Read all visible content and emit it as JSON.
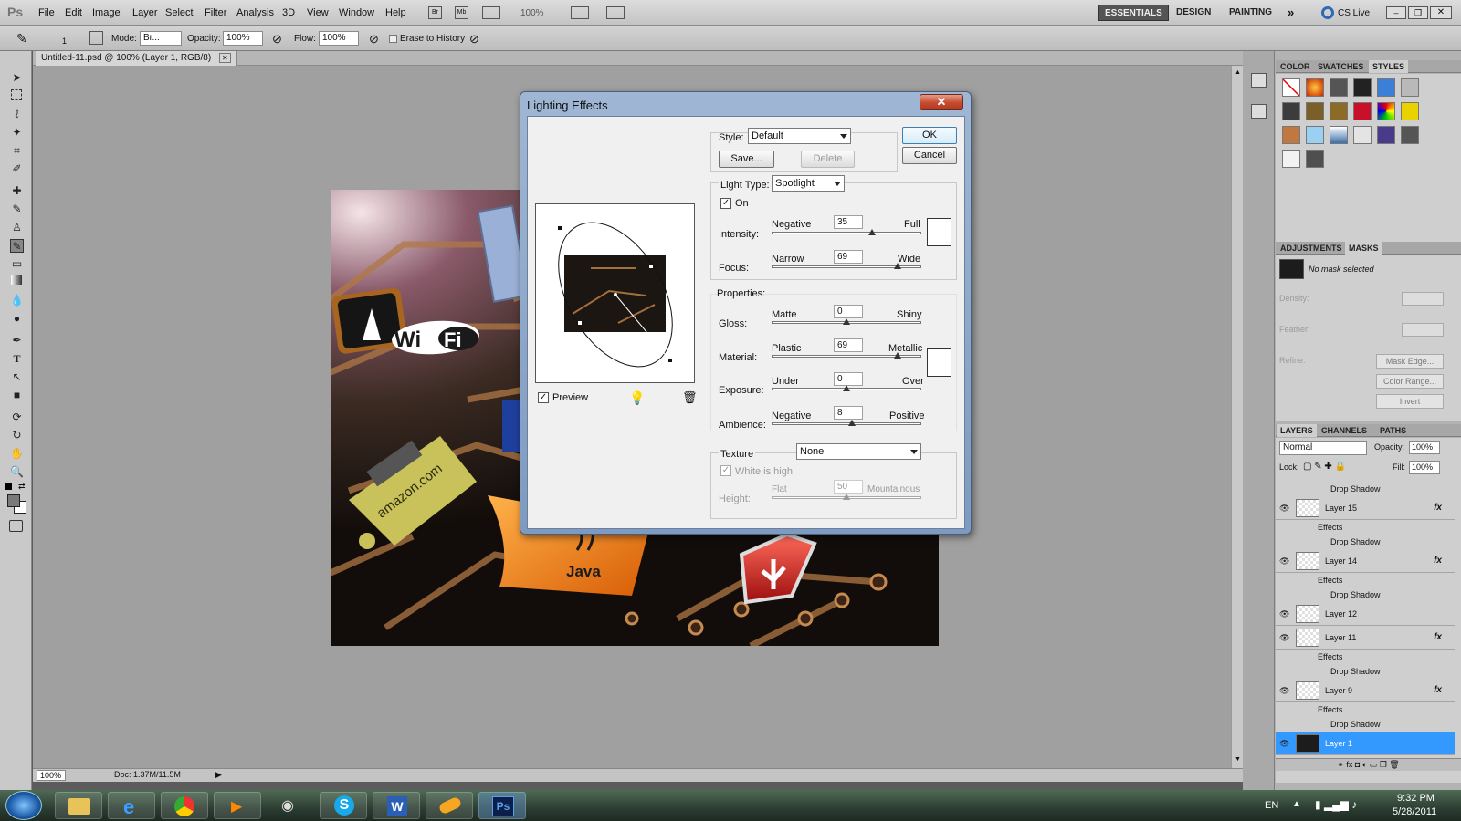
{
  "app": {
    "logo": "Ps"
  },
  "menu": [
    "File",
    "Edit",
    "Image",
    "Layer",
    "Select",
    "Filter",
    "Analysis",
    "3D",
    "View",
    "Window",
    "Help"
  ],
  "menu_zoom": "100%",
  "workspaces": [
    "ESSENTIALS",
    "DESIGN",
    "PAINTING"
  ],
  "cslive": "CS Live",
  "options": {
    "brush_size": "1",
    "mode_label": "Mode:",
    "mode_value": "Br...",
    "opacity_label": "Opacity:",
    "opacity_value": "100%",
    "flow_label": "Flow:",
    "flow_value": "100%",
    "erase_label": "Erase to History"
  },
  "document": {
    "tab_title": "Untitled-11.psd @ 100% (Layer 1, RGB/8)"
  },
  "status": {
    "zoom": "100%",
    "doc": "Doc: 1.37M/11.5M"
  },
  "image_labels": {
    "wifi_a": "Wi",
    "wifi_b": "Fi",
    "java": "Java",
    "amazon": "amazon.com"
  },
  "panels": {
    "color_tabs": [
      "COLOR",
      "SWATCHES",
      "STYLES"
    ],
    "adj_tabs": [
      "ADJUSTMENTS",
      "MASKS"
    ],
    "mask_text": "No mask selected",
    "density": "Density:",
    "feather": "Feather:",
    "refine": "Refine:",
    "mask_edge": "Mask Edge...",
    "color_range": "Color Range...",
    "invert": "Invert",
    "layer_tabs": [
      "LAYERS",
      "CHANNELS",
      "PATHS"
    ],
    "blend_mode": "Normal",
    "opacity_label": "Opacity:",
    "opacity_value": "100%",
    "lock_label": "Lock:",
    "fill_label": "Fill:",
    "fill_value": "100%",
    "effects_label": "Effects",
    "drop_shadow": "Drop Shadow",
    "layers": [
      "Layer 15",
      "Layer 14",
      "Layer 12",
      "Layer 11",
      "Layer 9",
      "Layer 1"
    ],
    "fx": "fx"
  },
  "dialog": {
    "title": "Lighting Effects",
    "style_label": "Style:",
    "style_value": "Default",
    "save": "Save...",
    "delete": "Delete",
    "ok": "OK",
    "cancel": "Cancel",
    "light_type_label": "Light Type:",
    "light_type_value": "Spotlight",
    "on_label": "On",
    "intensity_label": "Intensity:",
    "intensity_left": "Negative",
    "intensity_right": "Full",
    "intensity_value": "35",
    "focus_label": "Focus:",
    "focus_left": "Narrow",
    "focus_right": "Wide",
    "focus_value": "69",
    "properties_label": "Properties:",
    "gloss_label": "Gloss:",
    "gloss_left": "Matte",
    "gloss_right": "Shiny",
    "gloss_value": "0",
    "material_label": "Material:",
    "material_left": "Plastic",
    "material_right": "Metallic",
    "material_value": "69",
    "exposure_label": "Exposure:",
    "exposure_left": "Under",
    "exposure_right": "Over",
    "exposure_value": "0",
    "ambience_label": "Ambience:",
    "ambience_left": "Negative",
    "ambience_right": "Positive",
    "ambience_value": "8",
    "texture_label": "Texture",
    "texture_value": "None",
    "white_high": "White is high",
    "height_label": "Height:",
    "height_left": "Flat",
    "height_right": "Mountainous",
    "height_value": "50",
    "preview_label": "Preview"
  },
  "slider_levels": {
    "intensity": 0.675,
    "focus": 0.845,
    "gloss": 0.5,
    "material": 0.845,
    "exposure": 0.5,
    "ambience": 0.54,
    "height": 0.5
  },
  "taskbar": {
    "lang": "EN",
    "time": "9:32 PM",
    "date": "5/28/2011"
  },
  "colors": {
    "accent": "#3399ff",
    "dialog_frame": "#8aa6ca"
  }
}
